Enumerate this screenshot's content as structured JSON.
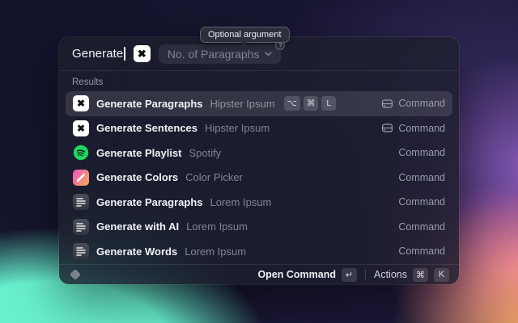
{
  "tooltip": {
    "text": "Optional argument"
  },
  "search": {
    "value": "Generate",
    "argument_placeholder": "No. of Paragraphs",
    "argument_badge": "?"
  },
  "results_header": "Results",
  "rows": [
    {
      "title": "Generate Paragraphs",
      "subtitle": "Hipster Ipsum",
      "icon": "hipster-ipsum-icon",
      "shortcut": [
        "⌥",
        "⌘",
        "L"
      ],
      "accessory": "Command",
      "accessory_icon": "drive-icon",
      "selected": true
    },
    {
      "title": "Generate Sentences",
      "subtitle": "Hipster Ipsum",
      "icon": "hipster-ipsum-icon",
      "accessory": "Command",
      "accessory_icon": "drive-icon"
    },
    {
      "title": "Generate Playlist",
      "subtitle": "Spotify",
      "icon": "spotify-icon",
      "accessory": "Command"
    },
    {
      "title": "Generate Colors",
      "subtitle": "Color Picker",
      "icon": "color-picker-icon",
      "accessory": "Command"
    },
    {
      "title": "Generate Paragraphs",
      "subtitle": "Lorem Ipsum",
      "icon": "lorem-ipsum-icon",
      "accessory": "Command"
    },
    {
      "title": "Generate with AI",
      "subtitle": "Lorem Ipsum",
      "icon": "lorem-ipsum-icon",
      "accessory": "Command"
    },
    {
      "title": "Generate Words",
      "subtitle": "Lorem Ipsum",
      "icon": "lorem-ipsum-icon",
      "accessory": "Command"
    }
  ],
  "footer": {
    "primary_action": "Open Command",
    "primary_key": "↵",
    "secondary_action": "Actions",
    "secondary_keys": [
      "⌘",
      "K"
    ]
  },
  "icons": {
    "hipster_glyph": "✖"
  },
  "colors": {
    "background_teal": "#68F0CD",
    "background_pink": "#F06FC4",
    "background_purple": "#9462C8",
    "background_orange": "#F2A65E",
    "spotify_green": "#1ED760",
    "picker_gradient_start": "#EE5FB8",
    "picker_gradient_end": "#F6A45F"
  }
}
